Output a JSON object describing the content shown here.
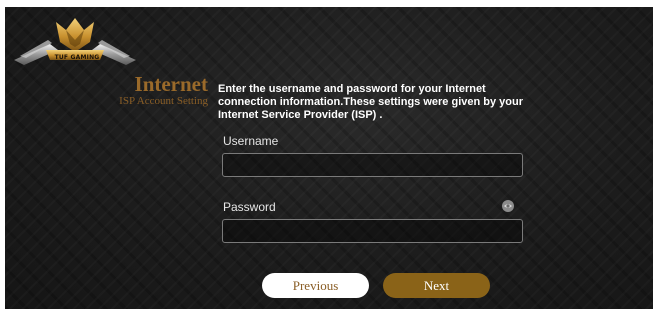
{
  "brand": {
    "logo_text": "TUF GAMING"
  },
  "section": {
    "title": "Internet",
    "subtitle": "ISP Account Setting"
  },
  "description": "Enter the username and password for your Internet connection information.These settings were given by your Internet Service Provider (ISP) .",
  "form": {
    "username": {
      "label": "Username",
      "value": "",
      "placeholder": ""
    },
    "password": {
      "label": "Password",
      "value": "",
      "placeholder": ""
    },
    "password_toggle_icon": "eye-icon"
  },
  "buttons": {
    "previous_label": "Previous",
    "next_label": "Next"
  },
  "colors": {
    "accent_gold": "#8a6318",
    "title_bronze": "#9a6a2a",
    "background": "#1c1c1c"
  }
}
